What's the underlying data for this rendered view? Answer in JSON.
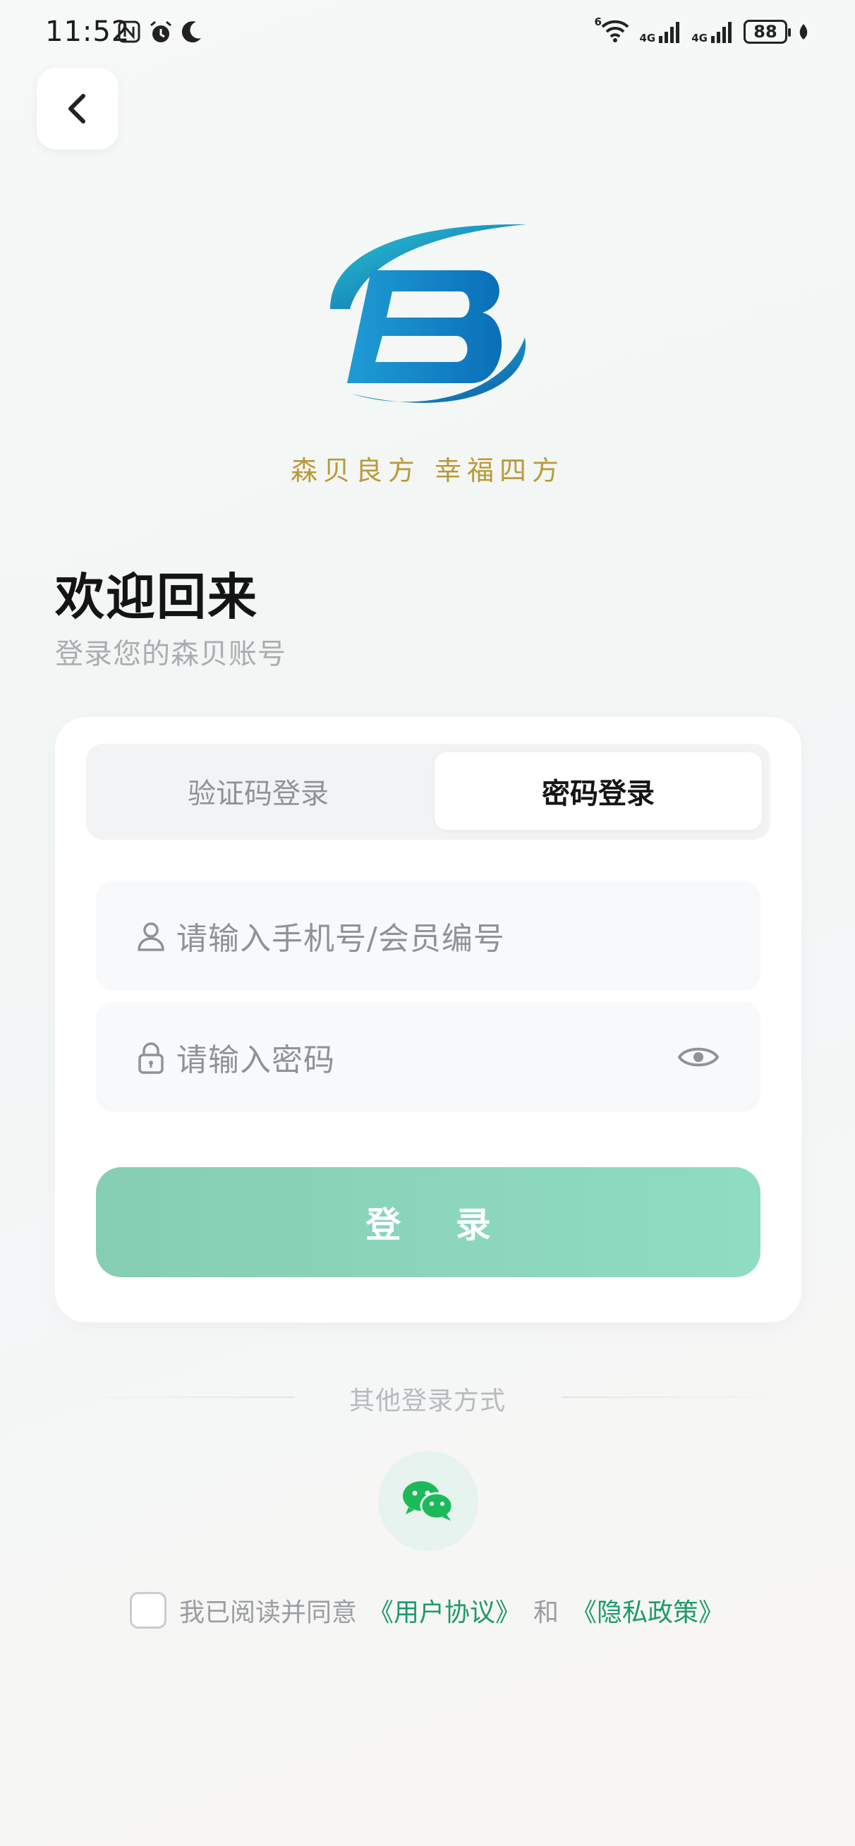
{
  "status_bar": {
    "time": "11:52",
    "network_1": "4G",
    "network_2": "4G",
    "wifi_tag": "6",
    "battery": "88"
  },
  "brand": {
    "slogan": "森贝良方 幸福四方"
  },
  "header": {
    "title": "欢迎回来",
    "subtitle": "登录您的森贝账号"
  },
  "login_card": {
    "tabs": [
      {
        "label": "验证码登录",
        "active": false
      },
      {
        "label": "密码登录",
        "active": true
      }
    ],
    "phone_placeholder": "请输入手机号/会员编号",
    "password_placeholder": "请输入密码",
    "login_label": "登 录"
  },
  "other_login": {
    "label": "其他登录方式",
    "wechat_icon": "wechat-icon"
  },
  "agreement": {
    "prefix": "我已阅读并同意",
    "user_agreement": "《用户协议》",
    "conjunction": "和",
    "privacy_policy": "《隐私政策》"
  },
  "colors": {
    "accent": "#1d9a6c",
    "button": "#8fd6bf",
    "slogan": "#b99a3a"
  }
}
